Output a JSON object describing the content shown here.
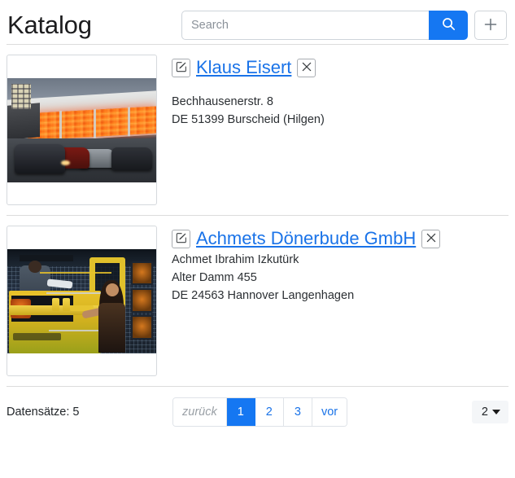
{
  "header": {
    "title": "Katalog",
    "search_placeholder": "Search",
    "search_value": "",
    "search_button_icon": "search-icon",
    "add_button_icon": "plus-icon"
  },
  "records": [
    {
      "edit_icon": "edit-pencil-square-icon",
      "title": "Klaus Eisert",
      "delete_icon": "close-x-icon",
      "thumbnail_alt": "car-dealership-at-dusk-with-red-lit-glass-facade",
      "lines": [
        "Bechhausenerstr. 8",
        "DE 51399 Burscheid (Hilgen)"
      ]
    },
    {
      "edit_icon": "edit-pencil-square-icon",
      "title": "Achmets Dönerbude GmbH",
      "delete_icon": "close-x-icon",
      "thumbnail_alt": "yellow-food-truck-with-vendor-and-customer",
      "lines": [
        "Achmet Ibrahim Izkutürk",
        "Alter Damm 455",
        "DE 24563 Hannover Langenhagen"
      ]
    }
  ],
  "footer": {
    "record_count_label": "Datensätze: 5",
    "pagination": {
      "prev_label": "zurück",
      "prev_disabled": true,
      "pages": [
        "1",
        "2",
        "3"
      ],
      "active_page": "1",
      "next_label": "vor"
    },
    "page_size": {
      "value": "2",
      "caret_icon": "caret-down-icon"
    }
  },
  "colors": {
    "primary_blue": "#1577f2",
    "link_blue": "#1a73e8",
    "divider": "#dcdcdc",
    "muted_text": "#9aa0a6"
  }
}
